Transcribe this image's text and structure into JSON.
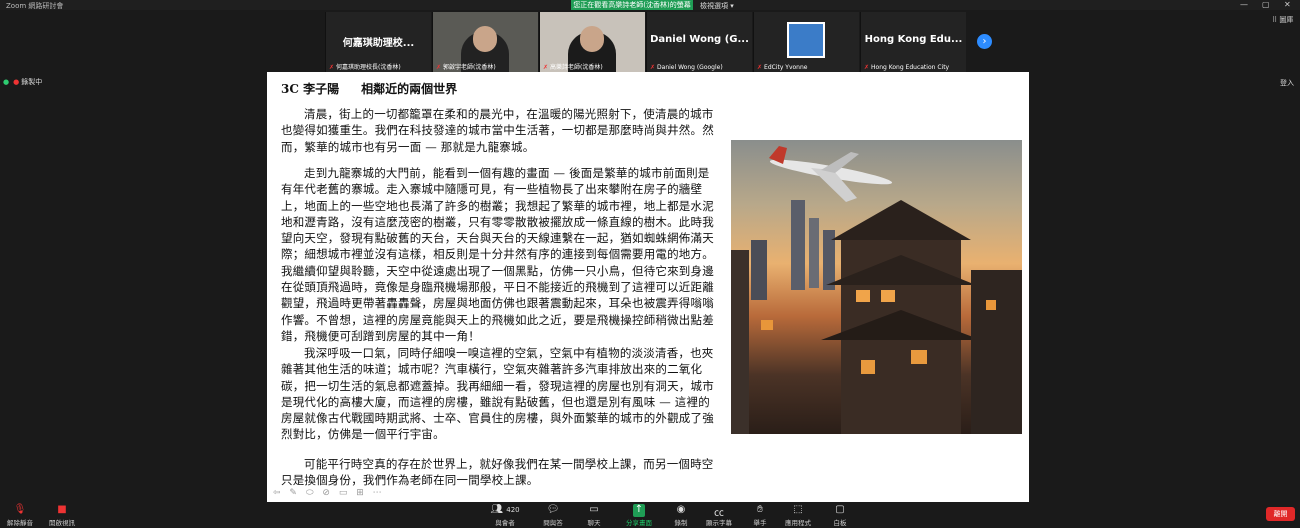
{
  "titlebar": {
    "app_title": "Zoom 網路研討會",
    "share_banner": "您正在觀看高樂詩老師(沈香林)的螢幕",
    "view_options": "檢視選項 ▾",
    "minimize": "—",
    "restore": "▢",
    "close": "✕"
  },
  "participants": [
    {
      "name": "何嘉琪助理校...",
      "label": "何嘉琪助理校長(沈香林)",
      "type": "name"
    },
    {
      "name": "",
      "label": "郭啟宇老師(沈香林)",
      "type": "video"
    },
    {
      "name": "",
      "label": "高樂詩老師(沈香林)",
      "type": "video2"
    },
    {
      "name": "Daniel Wong (G...",
      "label": "Daniel Wong (Google)",
      "type": "name"
    },
    {
      "name": "",
      "label": "EdCity Yvonne",
      "type": "doc"
    },
    {
      "name": "Hong Kong Edu...",
      "label": "Hong Kong Education City",
      "type": "name"
    }
  ],
  "strip_next": "›",
  "gallery_button": "⠿ 圖庫",
  "recording": "錄製中",
  "login": "登入",
  "document": {
    "title_class": "3C 李子陽",
    "title": "相鄰近的兩個世界",
    "paragraphs": [
      "清晨，街上的一切都籠罩在柔和的晨光中，在溫暖的陽光照射下，使清晨的城市也變得如獲重生。我們在科技發達的城市當中生活著，一切都是那麼時尚與井然。然而，繁華的城市也有另一面 — 那就是九龍寨城。",
      "走到九龍寨城的大門前，能看到一個有趣的畫面 — 後面是繁華的城市前面則是有年代老舊的寨城。走入寨城中隨隱可見，有一些植物長了出來攀附在房子的牆壁上，地面上的一些空地也長滿了許多的樹叢；我想起了繁華的城市裡，地上都是水泥地和瀝青路，沒有這麼茂密的樹叢，只有零零散散被擺放成一條直線的樹木。此時我望向天空，發現有點破舊的天台，天台與天台的天線連繫在一起，猶如蜘蛛網佈滿天際；細想城市裡並沒有這樣，相反則是十分井然有序的連接到每個需要用電的地方。我繼續仰望與聆聽，天空中從遠處出現了一個黑點，仿佛一只小鳥，但待它來到身邊在從頭頂飛過時，竟像是身臨飛機場那般，平日不能接近的飛機到了這裡可以近距離觀望，飛過時更帶著轟轟聲，房屋與地面仿佛也跟著震動起來，耳朵也被震弄得嗡嗡作響。不曾想，這裡的房屋竟能與天上的飛機如此之近，要是飛機操控師稍微出點差錯，飛機便可刮蹭到房屋的其中一角！",
      "我深呼吸一口氣，同時仔細嗅一嗅這裡的空氣，空氣中有植物的淡淡清香，也夾雜著其他生活的味道；城市呢？汽車橫行，空氣夾雜著許多汽車排放出來的二氧化碳，把一切生活的氣息都遮蓋掉。我再細細一看，發現這裡的房屋也別有洞天，城市是現代化的高樓大廈，而這裡的房樓，雖說有點破舊，但也還是別有風味 — 這裡的房屋就像古代戰國時期武將、士卒、官員住的房樓，與外面繁華的城市的外觀成了強烈對比，仿佛是一個平行宇宙。",
      "可能平行時空真的存在於世界上，就好像我們在某一間學校上課，而另一個時空只是換個身份，我們作為老師在同一間學校上課。"
    ]
  },
  "annotation_tools": [
    "⇦",
    "✎",
    "⬭",
    "⊘",
    "▭",
    "⊞",
    "⋯"
  ],
  "toolbar": {
    "mute": "解除靜音",
    "video": "開啟視訊",
    "participants_count": "420",
    "participants": "與會者",
    "qa": "問與答",
    "chat": "聊天",
    "share": "分享畫面",
    "record": "錄制",
    "cc": "顯示字幕",
    "raise": "舉手",
    "apps": "應用程式",
    "whiteboard": "白板",
    "leave": "離開"
  },
  "colors": {
    "accent_green": "#1f9d55",
    "leave_red": "#e02828",
    "mic_red": "#e33333",
    "blue": "#2d8cff"
  }
}
